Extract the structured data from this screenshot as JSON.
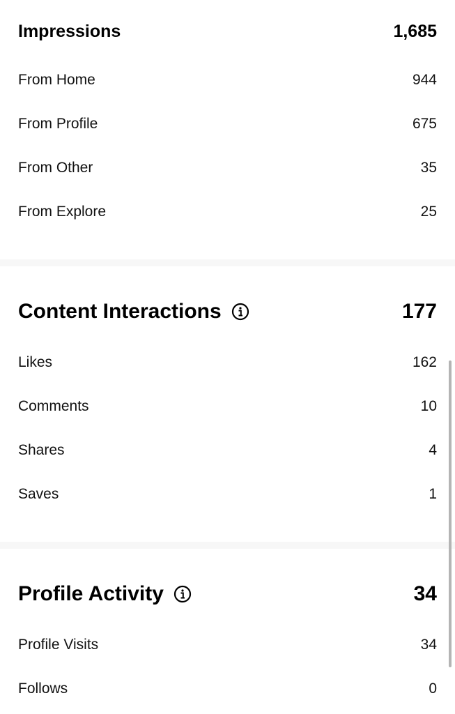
{
  "impressions": {
    "title": "Impressions",
    "total": "1,685",
    "rows": [
      {
        "label": "From Home",
        "value": "944"
      },
      {
        "label": "From Profile",
        "value": "675"
      },
      {
        "label": "From Other",
        "value": "35"
      },
      {
        "label": "From Explore",
        "value": "25"
      }
    ]
  },
  "content_interactions": {
    "title": "Content Interactions",
    "total": "177",
    "icon": "info-icon",
    "rows": [
      {
        "label": "Likes",
        "value": "162"
      },
      {
        "label": "Comments",
        "value": "10"
      },
      {
        "label": "Shares",
        "value": "4"
      },
      {
        "label": "Saves",
        "value": "1"
      }
    ]
  },
  "profile_activity": {
    "title": "Profile Activity",
    "total": "34",
    "icon": "info-icon",
    "rows": [
      {
        "label": "Profile Visits",
        "value": "34"
      },
      {
        "label": "Follows",
        "value": "0"
      }
    ]
  },
  "colors": {
    "text": "#000000",
    "divider": "#f7f7f7",
    "scrollbar": "#b4b4b4"
  }
}
